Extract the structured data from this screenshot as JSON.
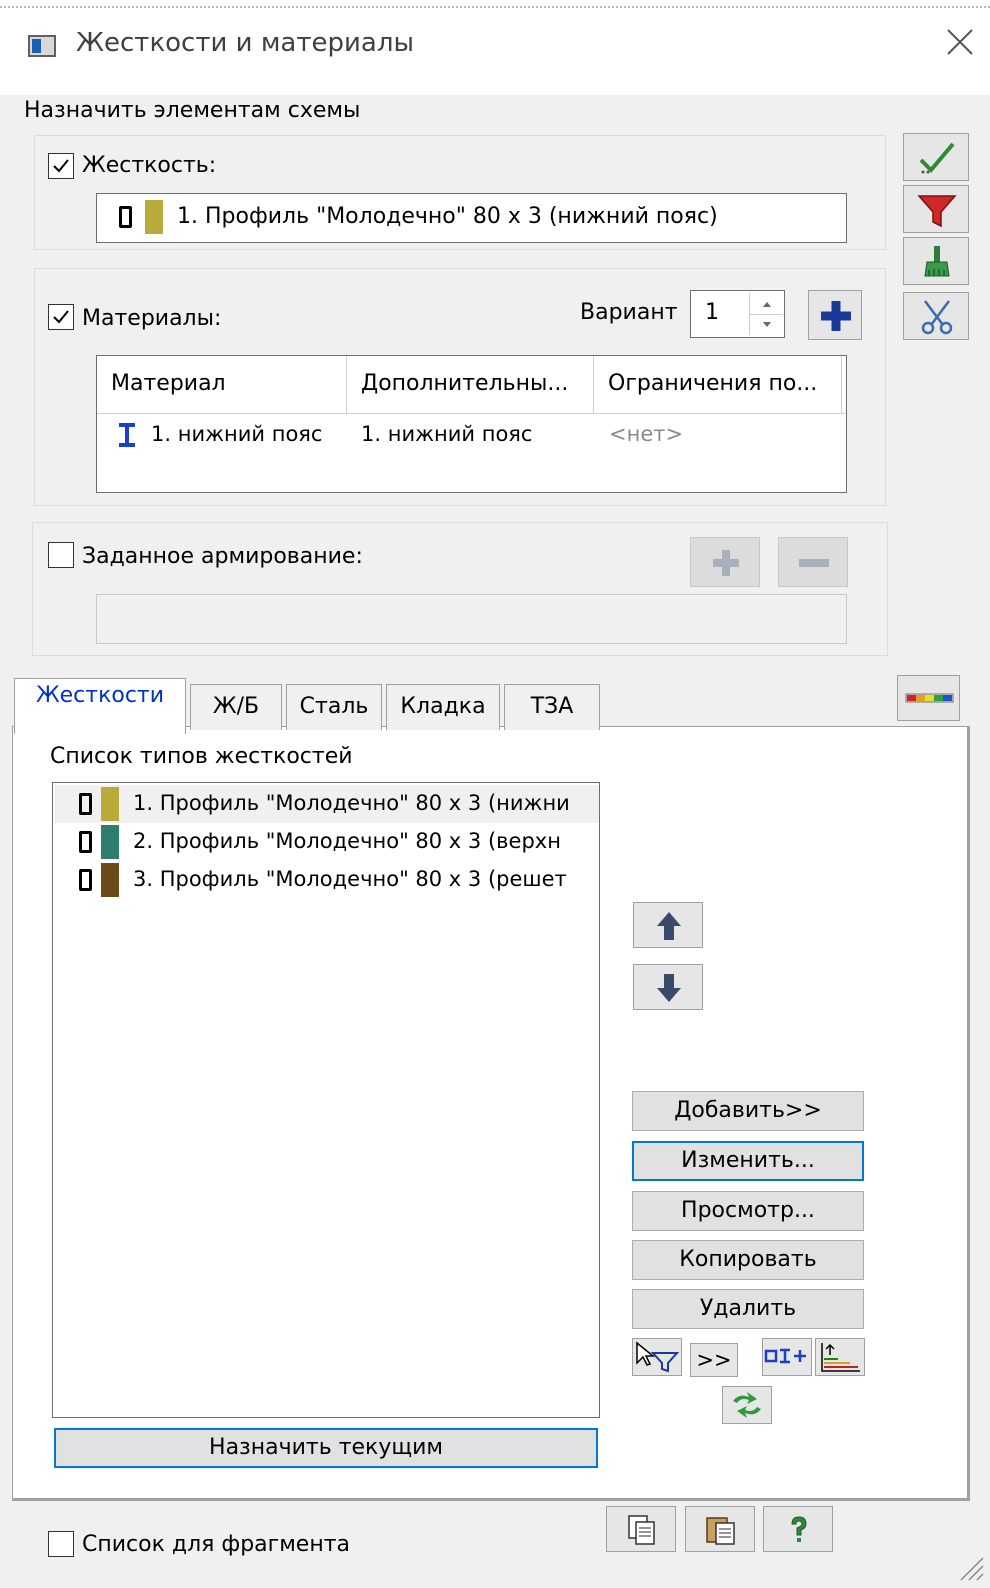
{
  "window": {
    "title": "Жесткости и материалы",
    "icon": "window-app-icon",
    "close_icon": "close-icon"
  },
  "assign": {
    "group_label": "Назначить элементам схемы",
    "stiffness": {
      "checked": true,
      "label": "Жесткость:",
      "value": "1. Профиль \"Молодечно\" 80 х 3 (нижний пояс)",
      "swatch_color": "#b8ab3c"
    },
    "materials": {
      "checked": true,
      "label": "Материалы:",
      "variant_label": "Вариант",
      "variant_value": "1",
      "columns": [
        "Материал",
        "Дополнительны...",
        "Ограничения по..."
      ],
      "rows": [
        {
          "material": "1. нижний пояс",
          "additional": "1. нижний пояс",
          "limits": "<нет>"
        }
      ]
    },
    "reinforcement": {
      "checked": false,
      "label": "Заданное армирование:"
    }
  },
  "tabs": [
    "Жесткости",
    "Ж/Б",
    "Сталь",
    "Кладка",
    "ТЗА"
  ],
  "active_tab": "Жесткости",
  "stiffness_list": {
    "label": "Список типов жесткостей",
    "items": [
      {
        "text": "1. Профиль \"Молодечно\" 80 х 3 (нижни",
        "color": "#b8ab3c"
      },
      {
        "text": "2. Профиль \"Молодечно\" 80 х 3 (верхн",
        "color": "#2e7d6e"
      },
      {
        "text": "3. Профиль \"Молодечно\" 80 х 3 (решет",
        "color": "#6b4a1a"
      }
    ]
  },
  "buttons": {
    "add": "Добавить>>",
    "edit": "Изменить...",
    "view": "Просмотр...",
    "copy": "Копировать",
    "delete": "Удалить",
    "more": ">>",
    "assign_current": "Назначить текущим"
  },
  "footer": {
    "fragment_list_label": "Список для фрагмента",
    "fragment_checked": false
  },
  "colors": {
    "accent": "#0078d7",
    "tab_active_text": "#0033cc",
    "icon_blue": "#1a3fd0"
  }
}
